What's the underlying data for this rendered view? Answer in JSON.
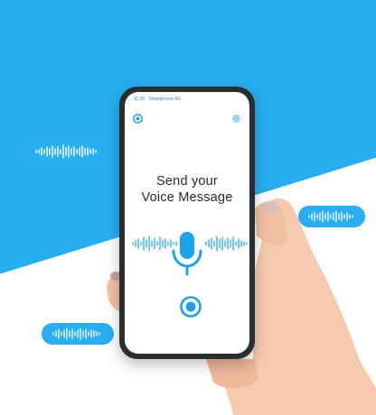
{
  "phone": {
    "status": {
      "time": "11:20",
      "carrier": "Smartphone 4G"
    },
    "screen": {
      "title_line1": "Send your",
      "title_line2": "Voice Message"
    }
  },
  "icons": {
    "top_left": "settings-ring-icon",
    "top_right": "gear-icon",
    "center": "microphone-icon",
    "bottom": "record-icon",
    "bubble": "sound-wave-icon"
  },
  "colors": {
    "accent": "#1ba3ea",
    "background_blue": "#27aef0",
    "bubble": "#29aef2",
    "phone_frame": "#2b2d30"
  }
}
